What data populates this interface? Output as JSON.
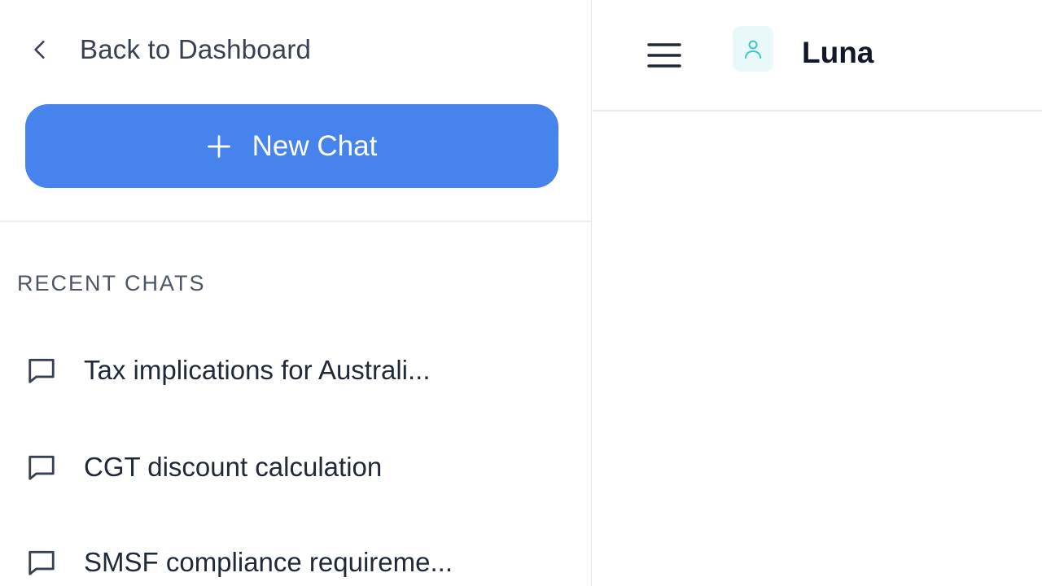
{
  "sidebar": {
    "back_label": "Back to Dashboard",
    "new_chat_label": "New Chat",
    "recent_title": "RECENT CHATS",
    "recent_chats": [
      {
        "title": "Tax implications for Australi..."
      },
      {
        "title": "CGT discount calculation"
      },
      {
        "title": "SMSF compliance requireme..."
      }
    ]
  },
  "header": {
    "assistant_name": "Luna"
  },
  "colors": {
    "primary": "#4683ec",
    "avatar_bg": "#e9f8f8",
    "avatar_icon": "#3cc6c8"
  },
  "icons": {
    "back": "chevron-left-icon",
    "new_chat": "plus-icon",
    "chat_item": "message-square-icon",
    "menu": "hamburger-menu-icon",
    "avatar": "user-icon"
  }
}
